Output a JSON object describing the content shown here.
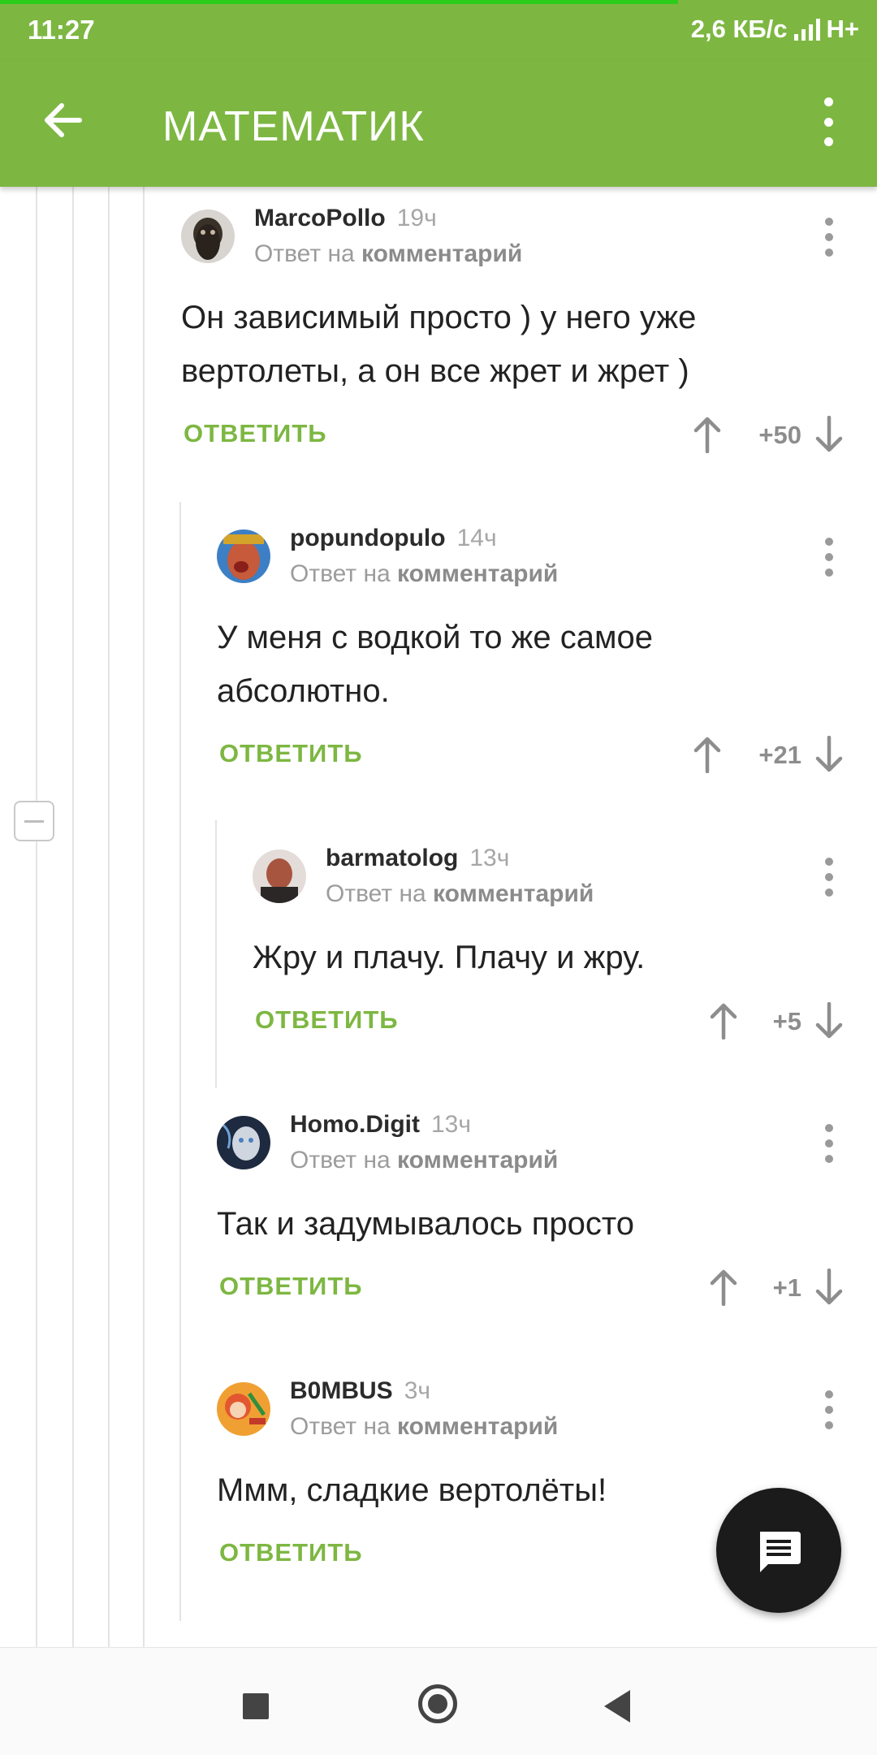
{
  "status_bar": {
    "time": "11:27",
    "speed": "2,6 КБ/с",
    "network": "H+"
  },
  "app_bar": {
    "title": "МАТЕМАТИК"
  },
  "comments": [
    {
      "author": "MarcoPollo",
      "time": "19ч",
      "reply_prefix": "Ответ на",
      "reply_link": "комментарий",
      "lines": [
        "Он зависимый просто ) у него уже",
        "вертолеты, а он все жрет и жрет )"
      ],
      "reply_label": "ОТВЕТИТЬ",
      "score": "+50"
    },
    {
      "author": "popundopulo",
      "time": "14ч",
      "reply_prefix": "Ответ на",
      "reply_link": "комментарий",
      "lines": [
        "У меня с водкой то же самое",
        "абсолютно."
      ],
      "reply_label": "ОТВЕТИТЬ",
      "score": "+21"
    },
    {
      "author": "barmatolog",
      "time": "13ч",
      "reply_prefix": "Ответ на",
      "reply_link": "комментарий",
      "lines": [
        "Жру и плачу. Плачу и жру."
      ],
      "reply_label": "ОТВЕТИТЬ",
      "score": "+5"
    },
    {
      "author": "Homo.Digit",
      "time": "13ч",
      "reply_prefix": "Ответ на",
      "reply_link": "комментарий",
      "lines": [
        "Так и задумывалось просто"
      ],
      "reply_label": "ОТВЕТИТЬ",
      "score": "+1"
    },
    {
      "author": "B0MBUS",
      "time": "3ч",
      "reply_prefix": "Ответ на",
      "reply_link": "комментарий",
      "lines": [
        "Ммм, сладкие вертолёты!"
      ],
      "reply_label": "ОТВЕТИТЬ"
    }
  ],
  "icons": {
    "back": "arrow-left-icon",
    "menu": "more-vertical-icon",
    "fab": "comment-icon",
    "upvote": "arrow-up-icon",
    "downvote": "arrow-down-icon"
  },
  "colors": {
    "accent": "#7db742",
    "fab": "#1b1b1b"
  }
}
